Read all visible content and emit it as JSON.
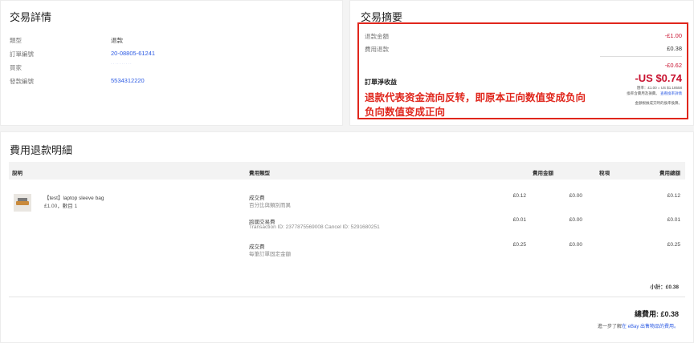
{
  "details": {
    "title": "交易詳情",
    "rows": [
      {
        "label": "類型",
        "value": "退款"
      },
      {
        "label": "訂單編號",
        "value": "20-08805-61241"
      },
      {
        "label": "買家",
        "value": "··········"
      },
      {
        "label": "發款編號",
        "value": "5534312220"
      }
    ]
  },
  "summary": {
    "title": "交易摘要",
    "refund_label": "退款金額",
    "refund_value": "-£1.00",
    "fee_refund_label": "費用退款",
    "fee_refund_value": "£0.38",
    "subtotal_value": "-£0.62",
    "net_label": "訂單淨收益",
    "net_value": "-US $0.74",
    "rate_line": "匯率：£1.00 = US $1.18558",
    "rate_note": "換率含費用及損費。",
    "rate_link": "查看換率詳情",
    "amount_note": "金額根據成交時的換率換算。",
    "annotation_line1": "退款代表资金流向反转，即原本正向数值变成负向",
    "annotation_line2": "负向数值变成正向"
  },
  "breakdown": {
    "title": "費用退款明細",
    "headers": {
      "desc": "說明",
      "type": "費用類型",
      "amount": "費用金額",
      "tax": "稅項",
      "total": "費用總額"
    },
    "item": {
      "name": "【test】laptop sleeve bag",
      "meta": "£1.00，數目 1"
    },
    "fees": [
      {
        "type": "成交費",
        "sub": "百分比與類別而異",
        "amount": "£0.12",
        "tax": "£0.00",
        "total": "£0.12"
      },
      {
        "type": "跨國交易費",
        "sub": "Transaction ID: 2377875569008 Cancel ID: 5291680251",
        "amount": "£0.01",
        "tax": "£0.00",
        "total": "£0.01"
      },
      {
        "type": "成交費",
        "sub": "每筆訂單固定金額",
        "amount": "£0.25",
        "tax": "£0.00",
        "total": "£0.25"
      }
    ],
    "subtotal": "小計：£0.38",
    "total": "總費用: £0.38",
    "learn_prefix": "進一步了解",
    "learn_link": "在 eBay 出售物品的費用。"
  },
  "colors": {
    "negative": "#c8102e",
    "link": "#2d5be3",
    "annotation": "#e0261c"
  }
}
